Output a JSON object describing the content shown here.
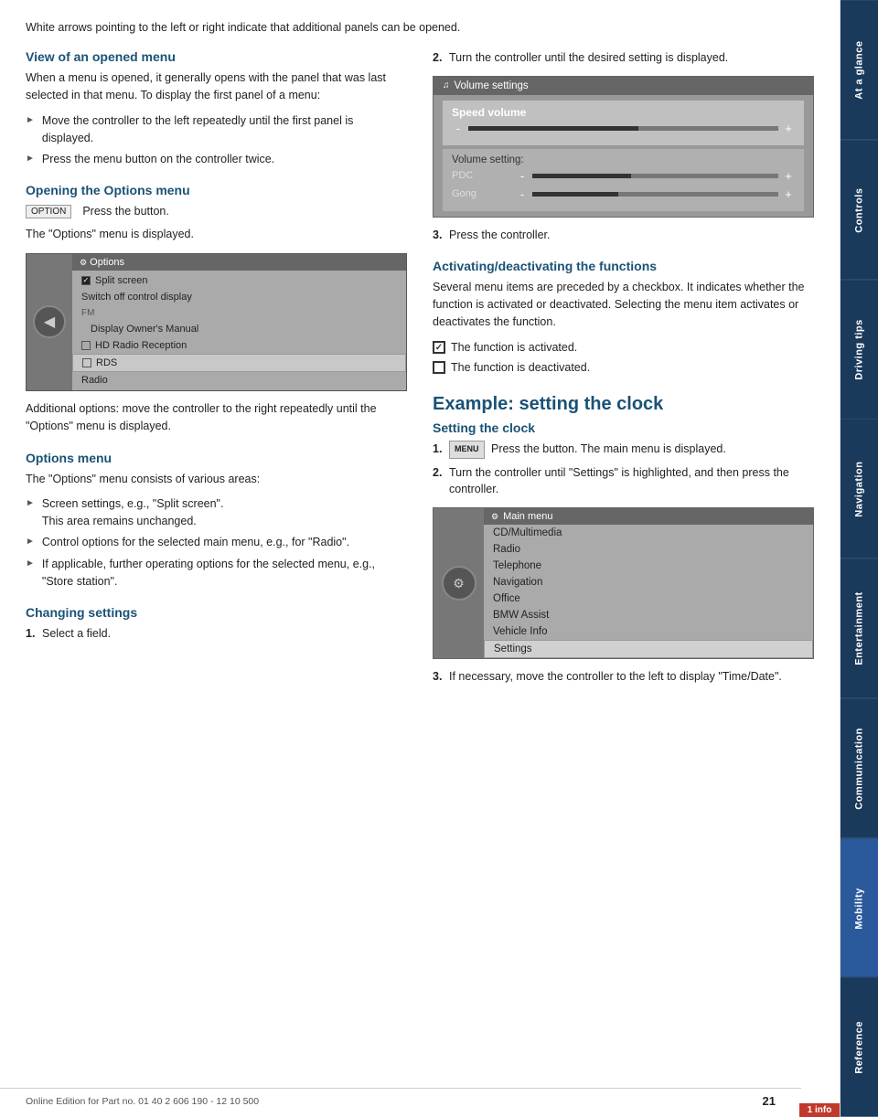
{
  "page": {
    "number": "21",
    "footer_text": "Online Edition for Part no. 01 40 2 606 190 - 12 10 500",
    "info_badge": "1 info"
  },
  "sidebar": {
    "tabs": [
      {
        "id": "at-a-glance",
        "label": "At a glance",
        "active": false
      },
      {
        "id": "controls",
        "label": "Controls",
        "active": false
      },
      {
        "id": "driving-tips",
        "label": "Driving tips",
        "active": false
      },
      {
        "id": "navigation",
        "label": "Navigation",
        "active": false
      },
      {
        "id": "entertainment",
        "label": "Entertainment",
        "active": false
      },
      {
        "id": "communication",
        "label": "Communication",
        "active": false
      },
      {
        "id": "mobility",
        "label": "Mobility",
        "active": true
      },
      {
        "id": "reference",
        "label": "Reference",
        "active": false
      }
    ]
  },
  "intro": {
    "text": "White arrows pointing to the left or right indicate that additional panels can be opened."
  },
  "col_left": {
    "section1": {
      "heading": "View of an opened menu",
      "body": "When a menu is opened, it generally opens with the panel that was last selected in that menu. To display the first panel of a menu:",
      "bullets": [
        "Move the controller to the left repeatedly until the first panel is displayed.",
        "Press the menu button on the controller twice."
      ]
    },
    "section2": {
      "heading": "Opening the Options menu",
      "button_label": "OPTION",
      "body1": "Press the button.",
      "body2": "The \"Options\" menu is displayed.",
      "screenshot": {
        "titlebar": "Options",
        "rows": [
          {
            "text": "Split screen",
            "type": "checkable",
            "checked": true,
            "indent": false
          },
          {
            "text": "Switch off control display",
            "type": "plain",
            "indent": false
          },
          {
            "text": "FM",
            "type": "section",
            "indent": false
          },
          {
            "text": "Display Owner's Manual",
            "type": "plain",
            "indent": true
          },
          {
            "text": "HD Radio Reception",
            "type": "checkable",
            "checked": false,
            "indent": false,
            "highlighted": false
          },
          {
            "text": "RDS",
            "type": "checkable",
            "checked": false,
            "indent": false,
            "selected": true
          },
          {
            "text": "Radio",
            "type": "plain",
            "indent": false
          }
        ]
      },
      "additional_text": "Additional options: move the controller to the right repeatedly until the \"Options\" menu is displayed."
    },
    "section3": {
      "heading": "Options menu",
      "body": "The \"Options\" menu consists of various areas:",
      "bullets": [
        {
          "text": "Screen settings, e.g., \"Split screen\".",
          "sub": "This area remains unchanged."
        },
        {
          "text": "Control options for the selected main menu, e.g., for \"Radio\"."
        },
        {
          "text": "If applicable, further operating options for the selected menu, e.g., \"Store station\"."
        }
      ]
    },
    "section4": {
      "heading": "Changing settings",
      "numbered": [
        {
          "num": "1.",
          "text": "Select a field."
        }
      ]
    }
  },
  "col_right": {
    "step2_text": "Turn the controller until the desired setting is displayed.",
    "vol_screenshot": {
      "titlebar": "Volume settings",
      "items": [
        {
          "label": "Speed volume",
          "sliders": [
            {
              "label": "",
              "fill_pct": 55
            }
          ]
        },
        {
          "label": "Volume setting:",
          "sliders": [
            {
              "label": "PDC",
              "fill_pct": 40
            },
            {
              "label": "Gong",
              "fill_pct": 35
            }
          ]
        }
      ]
    },
    "step3_text": "Press the controller.",
    "section_activate": {
      "heading": "Activating/deactivating the functions",
      "body": "Several menu items are preceded by a checkbox. It indicates whether the function is activated or deactivated. Selecting the menu item activates or deactivates the function.",
      "activated_text": "The function is activated.",
      "deactivated_text": "The function is deactivated."
    },
    "example_section": {
      "heading": "Example: setting the clock",
      "sub_heading": "Setting the clock",
      "steps": [
        {
          "num": "1.",
          "button_label": "MENU",
          "text": "Press the button. The main menu is displayed."
        },
        {
          "num": "2.",
          "text": "Turn the controller until \"Settings\" is highlighted, and then press the controller."
        }
      ],
      "main_menu_screenshot": {
        "titlebar": "Main menu",
        "rows": [
          {
            "text": "CD/Multimedia"
          },
          {
            "text": "Radio"
          },
          {
            "text": "Telephone"
          },
          {
            "text": "Navigation"
          },
          {
            "text": "Office"
          },
          {
            "text": "BMW Assist"
          },
          {
            "text": "Vehicle Info"
          },
          {
            "text": "Settings",
            "selected": true
          }
        ]
      },
      "step3_text": "If necessary, move the controller to the left to display \"Time/Date\"."
    }
  }
}
